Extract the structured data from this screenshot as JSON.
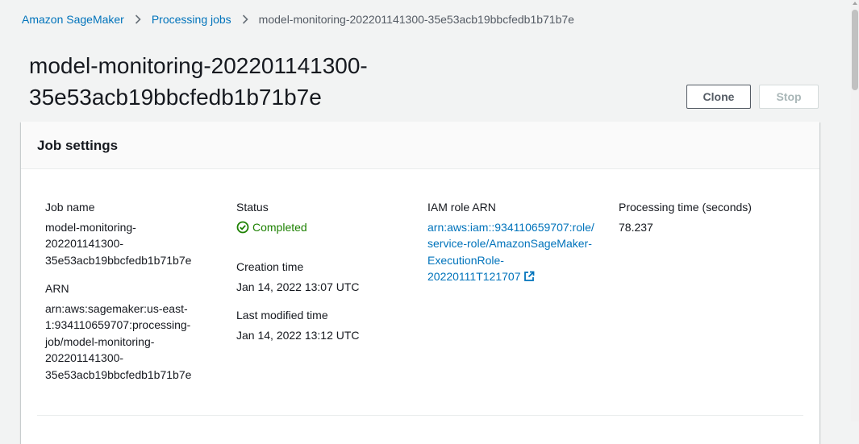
{
  "breadcrumb": {
    "items": [
      "Amazon SageMaker",
      "Processing jobs"
    ],
    "current": "model-monitoring-202201141300-35e53acb19bbcfedb1b71b7e"
  },
  "page": {
    "title": "model-monitoring-202201141300-35e53acb19bbcfedb1b71b7e",
    "title_line1": "model-monitoring-202201141300-",
    "title_line2": "35e53acb19bbcfedb1b71b7e"
  },
  "actions": {
    "clone_label": "Clone",
    "stop_label": "Stop"
  },
  "job_settings": {
    "heading": "Job settings",
    "job_name": {
      "label": "Job name",
      "lines": [
        "model-monitoring-",
        "202201141300-",
        "35e53acb19bbcfedb1b71b7e"
      ]
    },
    "arn": {
      "label": "ARN",
      "lines": [
        "arn:aws:sagemaker:us-east-",
        "1:934110659707:processing-",
        "job/model-monitoring-",
        "202201141300-",
        "35e53acb19bbcfedb1b71b7e"
      ]
    },
    "status": {
      "label": "Status",
      "value": "Completed",
      "color": "#1d8102"
    },
    "creation_time": {
      "label": "Creation time",
      "value": "Jan 14, 2022 13:07 UTC"
    },
    "last_modified_time": {
      "label": "Last modified time",
      "value": "Jan 14, 2022 13:12 UTC"
    },
    "iam_role_arn": {
      "label": "IAM role ARN",
      "lines": [
        "arn:aws:iam::934110659707:role/",
        "service-role/AmazonSageMaker-",
        "ExecutionRole-",
        "20220111T121707"
      ]
    },
    "processing_time": {
      "label": "Processing time (seconds)",
      "value": "78.237"
    }
  },
  "colors": {
    "link": "#0073bb",
    "background": "#f2f3f3",
    "text": "#16191f"
  }
}
